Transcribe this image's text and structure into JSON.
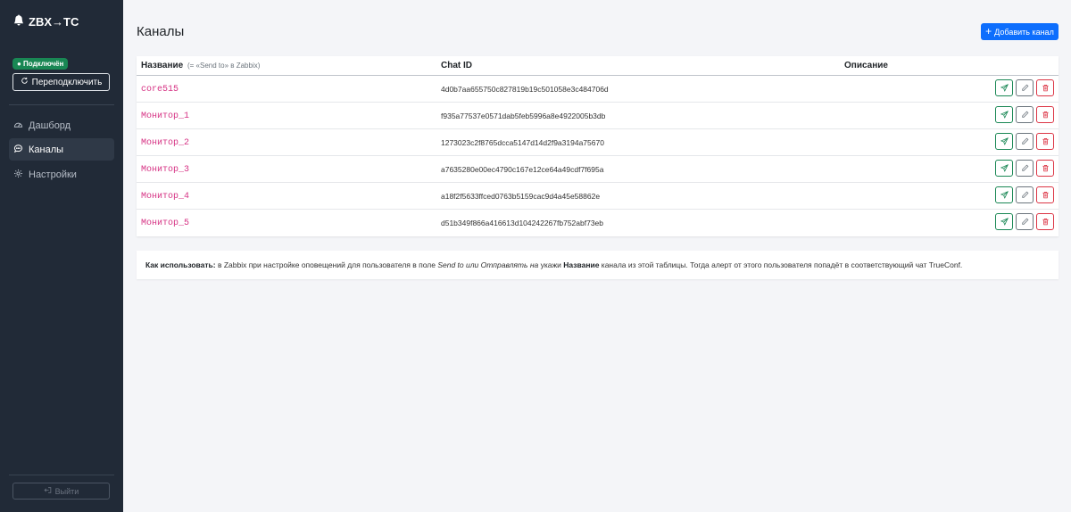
{
  "brand": {
    "name": "ZBX→TC"
  },
  "status": {
    "connected_label": "● Подключён",
    "reconnect_label": "Переподключить"
  },
  "nav": [
    {
      "label": "Дашборд",
      "icon": "speedometer-icon"
    },
    {
      "label": "Каналы",
      "icon": "chat-icon",
      "active": true
    },
    {
      "label": "Настройки",
      "icon": "gear-icon"
    }
  ],
  "logout_label": "Выйти",
  "page": {
    "title": "Каналы",
    "add_button": "Добавить канал"
  },
  "table": {
    "headers": {
      "name": "Название",
      "name_hint": "(= «Send to» в Zabbix)",
      "chat_id": "Chat ID",
      "description": "Описание"
    },
    "rows": [
      {
        "name": "core515",
        "chat_id": "4d0b7aa655750c827819b19c501058e3c484706d",
        "description": ""
      },
      {
        "name": "Монитор_1",
        "chat_id": "f935a77537e0571dab5feb5996a8e4922005b3db",
        "description": ""
      },
      {
        "name": "Монитор_2",
        "chat_id": "1273023c2f8765dcca5147d14d2f9a3194a75670",
        "description": ""
      },
      {
        "name": "Монитор_3",
        "chat_id": "a7635280e00ec4790c167e12ce64a49cdf7f695a",
        "description": ""
      },
      {
        "name": "Монитор_4",
        "chat_id": "a18f2f5633ffced0763b5159cac9d4a45e58862e",
        "description": ""
      },
      {
        "name": "Монитор_5",
        "chat_id": "d51b349f866a416613d104242267fb752abf73eb",
        "description": ""
      }
    ]
  },
  "info": {
    "lead": "Как использовать:",
    "text1": " в Zabbix при настройке оповещений для пользователя в поле ",
    "italic": "Send to или Отправлять на",
    "text2": " укажи ",
    "bold2": "Название",
    "text3": " канала из этой таблицы. Тогда алерт от этого пользователя попадёт в соответствующий чат TrueConf."
  },
  "colors": {
    "sidebar": "#212a37",
    "primary": "#0d6efd",
    "success": "#198754",
    "danger": "#dc3545",
    "code": "#d63384"
  }
}
